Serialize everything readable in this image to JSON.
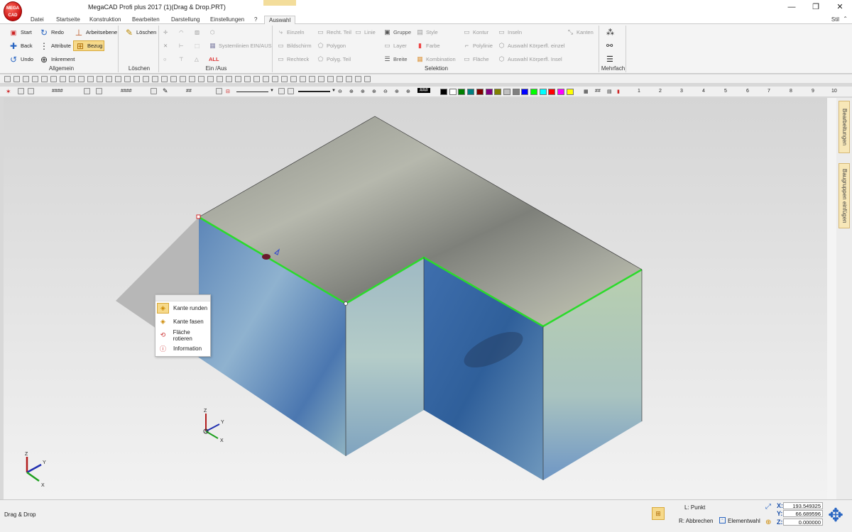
{
  "app": {
    "logo_text": "MEGA CAD",
    "title": "MegaCAD Profi plus 2017 (1)(Drag & Drop.PRT)",
    "window_buttons": [
      "—",
      "❐",
      "✕"
    ],
    "style_label": "Stil",
    "style_chevron": "⌃"
  },
  "tabs": [
    "Datei",
    "Startseite",
    "Konstruktion",
    "Bearbeiten",
    "Darstellung",
    "Einstellungen",
    "?",
    "Auswahl"
  ],
  "active_tab": "Auswahl",
  "ribbon": {
    "allgemein": {
      "label": "Allgemein",
      "start": "Start",
      "redo": "Redo",
      "arbeitsebene": "Arbeitsebene",
      "back": "Back",
      "attribute": "Attribute",
      "bezug": "Bezug",
      "undo": "Undo",
      "inkrement": "Inkrement"
    },
    "loeschen": {
      "label": "Löschen",
      "button": "Löschen"
    },
    "einaus": {
      "label": "Ein /Aus",
      "systemlinien": "Systemlinien EIN/AUS",
      "all": "ALL"
    },
    "selektion": {
      "label": "Selektion",
      "einzeln": "Einzeln",
      "recht_teil": "Recht. Teil",
      "linie": "Linie",
      "gruppe": "Gruppe",
      "style": "Style",
      "bildschirm": "Bildschirm",
      "polygon": "Polygon",
      "layer": "Layer",
      "farbe": "Farbe",
      "rechteck": "Rechteck",
      "polyg_teil": "Polyg. Teil",
      "breite": "Breite",
      "kombination": "Kombination",
      "kontur": "Kontur",
      "inseln": "Inseln",
      "kanten": "Kanten",
      "polylinie": "Polylinie",
      "auswahl_einzeln": "Auswahl Körperfl. einzel",
      "flaeche": "Fläche",
      "auswahl_insel": "Auswahl Körperfl. Insel"
    },
    "mehrfach": {
      "label": "Mehrfach"
    }
  },
  "toolbar2": {
    "field1": "####",
    "field2": "####",
    "field3": "##",
    "field4": "###",
    "numbers": [
      "1",
      "2",
      "3",
      "4",
      "5",
      "6",
      "7",
      "8",
      "9",
      "10"
    ],
    "colors": [
      "#000000",
      "#ffffff",
      "#008000",
      "#008080",
      "#800000",
      "#800080",
      "#808000",
      "#c0c0c0",
      "#808080",
      "#0000ff",
      "#00ff00",
      "#00ffff",
      "#ff0000",
      "#ff00ff",
      "#ffff00"
    ]
  },
  "context_menu": {
    "items": [
      {
        "label": "Kante runden",
        "icon": "edge-round-icon"
      },
      {
        "label": "Kante fasen",
        "icon": "edge-chamfer-icon"
      },
      {
        "label": "Fläche rotieren",
        "icon": "face-rotate-icon"
      },
      {
        "label": "Information",
        "icon": "info-icon"
      }
    ],
    "highlighted_index": 0
  },
  "sidebar": {
    "tab1": "Bearbeitungen",
    "tab2": "Baugruppen einfügen"
  },
  "axes": {
    "z": "Z",
    "y": "Y",
    "x": "X"
  },
  "status": {
    "mode": "Drag & Drop",
    "left_button": "L: Punkt",
    "right_button": "R: Abbrechen",
    "element_select": "Elementwahl",
    "x_label": "X:",
    "y_label": "Y:",
    "z_label": "Z:",
    "x": "193.549325",
    "y": "66.689596",
    "z": "0.000000"
  }
}
